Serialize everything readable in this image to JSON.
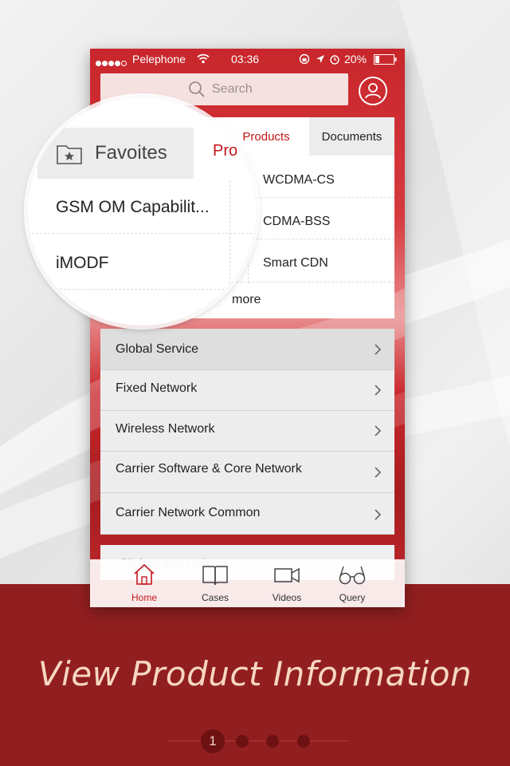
{
  "status_bar": {
    "carrier": "Pelephone",
    "time": "03:36",
    "battery": "20%"
  },
  "search": {
    "placeholder": "Search"
  },
  "tabs": {
    "favorites": "Favoites",
    "products": "Products",
    "products_partial": "Pro",
    "documents": "Documents"
  },
  "products_grid": {
    "items": [
      "WCDMA-CS",
      "CDMA-BSS",
      "Smart CDN"
    ],
    "more": "more"
  },
  "magnifier_items": [
    "GSM OM Capabilit...",
    "iMODF"
  ],
  "categories": [
    "Global Service",
    "Fixed Network",
    "Wireless Network",
    "Carrier Software & Core Network",
    "Carrier Network Common"
  ],
  "notice": {
    "text": "Click to new notices"
  },
  "tabbar": {
    "items": [
      {
        "label": "Home",
        "icon": "home-icon"
      },
      {
        "label": "Cases",
        "icon": "book-icon"
      },
      {
        "label": "Videos",
        "icon": "video-camera-icon"
      },
      {
        "label": "Query",
        "icon": "glasses-icon"
      }
    ],
    "active": "Home"
  },
  "caption": "View Product Information",
  "pager": {
    "current": "1",
    "total_pages": 4
  },
  "colors": {
    "brand_red": "#c4161c",
    "band_red": "#921f20",
    "caption_color": "#f6d7c3"
  }
}
